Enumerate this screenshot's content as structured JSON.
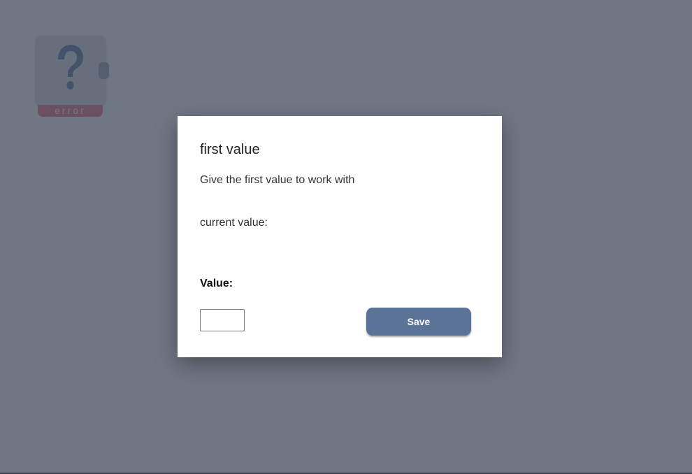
{
  "node": {
    "icon": "question-mark-icon",
    "status_label": "error",
    "icon_color": "#5b7ba6",
    "status_color": "#e8757f"
  },
  "modal": {
    "title": "first value",
    "description": "Give the first value to work with",
    "current_value_label": "current value:",
    "value_label": "Value:",
    "value_input": "",
    "save_label": "Save"
  },
  "colors": {
    "overlay": "#6d7480",
    "button": "#5a7396"
  }
}
